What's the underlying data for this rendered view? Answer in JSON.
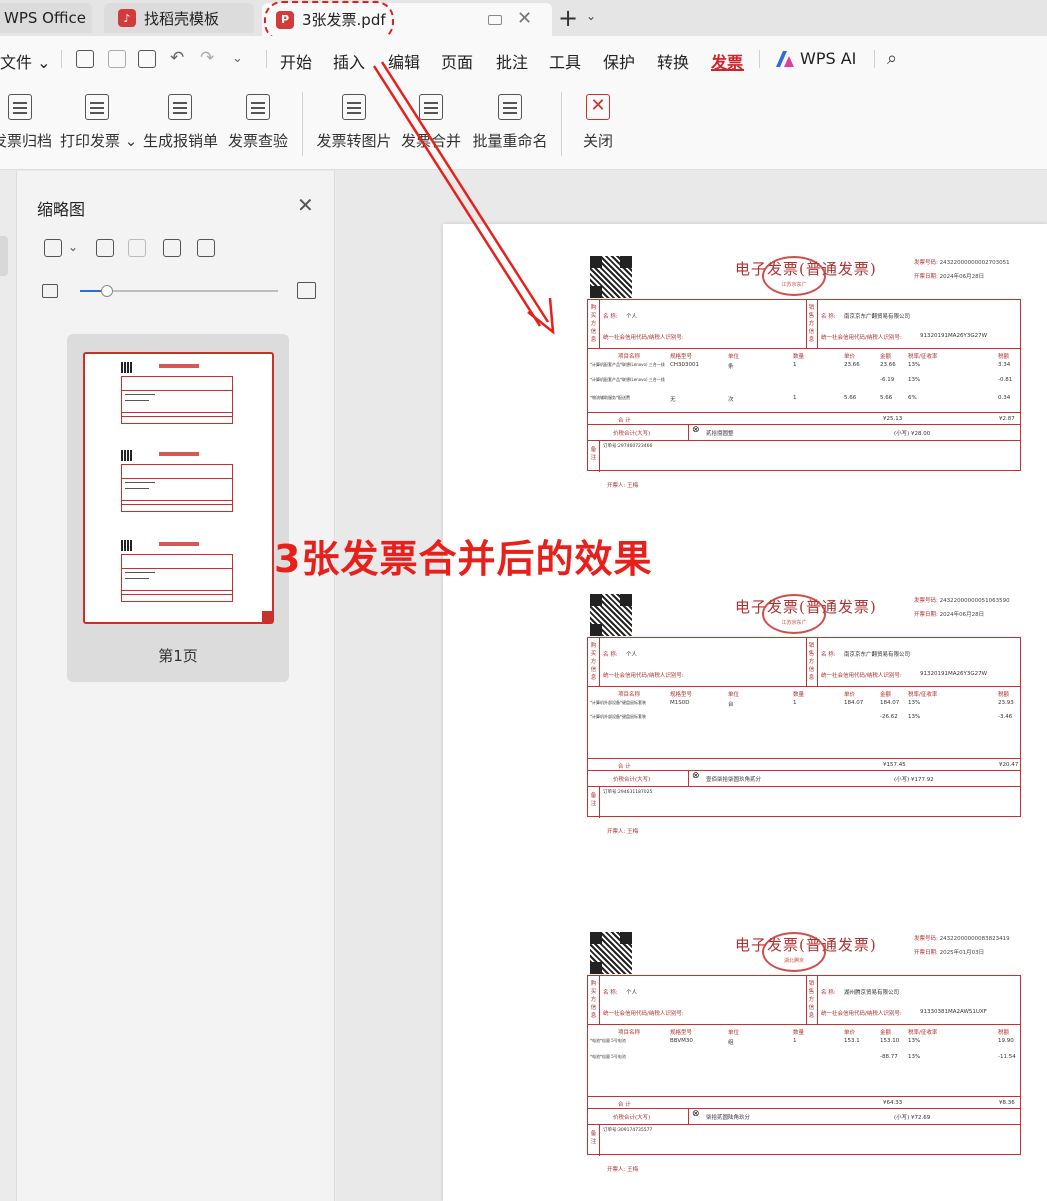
{
  "tabs": {
    "home": "WPS Office",
    "doc1": "找稻壳模板",
    "doc2": "3张发票.pdf"
  },
  "menubar": {
    "file": "文件",
    "items": [
      "开始",
      "插入",
      "编辑",
      "页面",
      "批注",
      "工具",
      "保护",
      "转换",
      "发票"
    ],
    "active": "发票",
    "ai": "WPS AI"
  },
  "ribbon": {
    "buttons": [
      "发票归档",
      "打印发票",
      "生成报销单",
      "发票查验",
      "发票转图片",
      "发票合并",
      "批量重命名",
      "关闭"
    ]
  },
  "thumbnail_panel": {
    "title": "缩略图",
    "page_label": "第1页"
  },
  "annotation": {
    "text": "3张发票合并后的效果",
    "color": "#e8201c"
  },
  "invoices": [
    {
      "title": "电子发票(普通发票)",
      "seal": "江苏京东广",
      "meta_no_label": "发票号码:",
      "meta_no": "24322000000002703051",
      "meta_date_label": "开票日期:",
      "meta_date": "2024年06月28日",
      "buyer_label": "购买方信息",
      "buyer_name_label": "名 称:",
      "buyer_name": "个人",
      "buyer_tax_label": "统一社会信用代码/纳税人识别号:",
      "seller_label": "销售方信息",
      "seller_name_label": "名 称:",
      "seller_name": "南京京东广翻贸易有限公司",
      "seller_tax_label": "统一社会信用代码/纳税人识别号:",
      "seller_tax": "91320191MA26Y3G27W",
      "headers": [
        "项目名称",
        "规格型号",
        "单位",
        "数量",
        "单价",
        "金额",
        "税率/征收率",
        "税额"
      ],
      "rows": [
        [
          "*计算机配套产品*联想(Lenovo) 三合一线",
          "CH303001",
          "条",
          "1",
          "23.66",
          "23.66",
          "13%",
          "3.34"
        ],
        [
          "*计算机配套产品*联想(Lenovo) 三合一线",
          "",
          "",
          "",
          "",
          "-6.19",
          "13%",
          "-0.81"
        ],
        [
          "*物流辅助服务*配送费",
          "无",
          "次",
          "1",
          "5.66",
          "5.66",
          "6%",
          "0.34"
        ]
      ],
      "total_label": "合 计",
      "total_amount": "¥25.13",
      "total_tax": "¥2.87",
      "cap_label": "价税合计(大写)",
      "cap_text": "贰拾捌圆整",
      "cap_small": "(小写) ¥28.00",
      "remark_label": "备注",
      "remark": "订单号:297460723466",
      "drawer": "开票人: 王梅"
    },
    {
      "title": "电子发票(普通发票)",
      "seal": "江苏京东广",
      "meta_no_label": "发票号码:",
      "meta_no": "24322000000051063590",
      "meta_date_label": "开票日期:",
      "meta_date": "2024年06月28日",
      "buyer_label": "购买方信息",
      "buyer_name_label": "名 称:",
      "buyer_name": "个人",
      "buyer_tax_label": "统一社会信用代码/纳税人识别号:",
      "seller_label": "销售方信息",
      "seller_name_label": "名 称:",
      "seller_name": "南京京东广翻贸易有限公司",
      "seller_tax_label": "统一社会信用代码/纳税人识别号:",
      "seller_tax": "91320191MA26Y3G27W",
      "headers": [
        "项目名称",
        "规格型号",
        "单位",
        "数量",
        "单价",
        "金额",
        "税率/征收率",
        "税额"
      ],
      "rows": [
        [
          "*计算机外部设备*键盘鼠标套装",
          "M1S0D",
          "台",
          "1",
          "184.07",
          "184.07",
          "13%",
          "23.93"
        ],
        [
          "*计算机外部设备*键盘鼠标套装",
          "",
          "",
          "",
          "",
          "-26.62",
          "13%",
          "-3.46"
        ]
      ],
      "total_label": "合 计",
      "total_amount": "¥157.45",
      "total_tax": "¥20.47",
      "cap_label": "价税合计(大写)",
      "cap_text": "壹佰柒拾柒圆玖角贰分",
      "cap_small": "(小写) ¥177.92",
      "remark_label": "备注",
      "remark": "订单号:294631187025",
      "drawer": "开票人: 王梅"
    },
    {
      "title": "电子发票(普通发票)",
      "seal": "湖北腾京",
      "meta_no_label": "发票号码:",
      "meta_no": "24322000000083823419",
      "meta_date_label": "开票日期:",
      "meta_date": "2025年01月03日",
      "buyer_label": "购买方信息",
      "buyer_name_label": "名 称:",
      "buyer_name": "个人",
      "buyer_tax_label": "统一社会信用代码/纳税人识别号:",
      "seller_label": "销售方信息",
      "seller_name_label": "名 称:",
      "seller_name": "湖州腾京贸易有限公司",
      "seller_tax_label": "统一社会信用代码/纳税人识别号:",
      "seller_tax": "91330381MA2AW51UXF",
      "headers": [
        "项目名称",
        "规格型号",
        "单位",
        "数量",
        "单价",
        "金额",
        "税率/征收率",
        "税额"
      ],
      "rows": [
        [
          "*电池*倍量 5号电池",
          "BBVM30",
          "组",
          "1",
          "153.1",
          "153.10",
          "13%",
          "19.90"
        ],
        [
          "*电池*倍量 5号电池",
          "",
          "",
          "",
          "",
          "-88.77",
          "13%",
          "-11.54"
        ]
      ],
      "total_label": "合 计",
      "total_amount": "¥64.33",
      "total_tax": "¥8.36",
      "cap_label": "价税合计(大写)",
      "cap_text": "柒拾贰圆陆角玖分",
      "cap_small": "(小写) ¥72.69",
      "remark_label": "备注",
      "remark": "订单号:309174735577",
      "drawer": "开票人: 王梅"
    }
  ]
}
